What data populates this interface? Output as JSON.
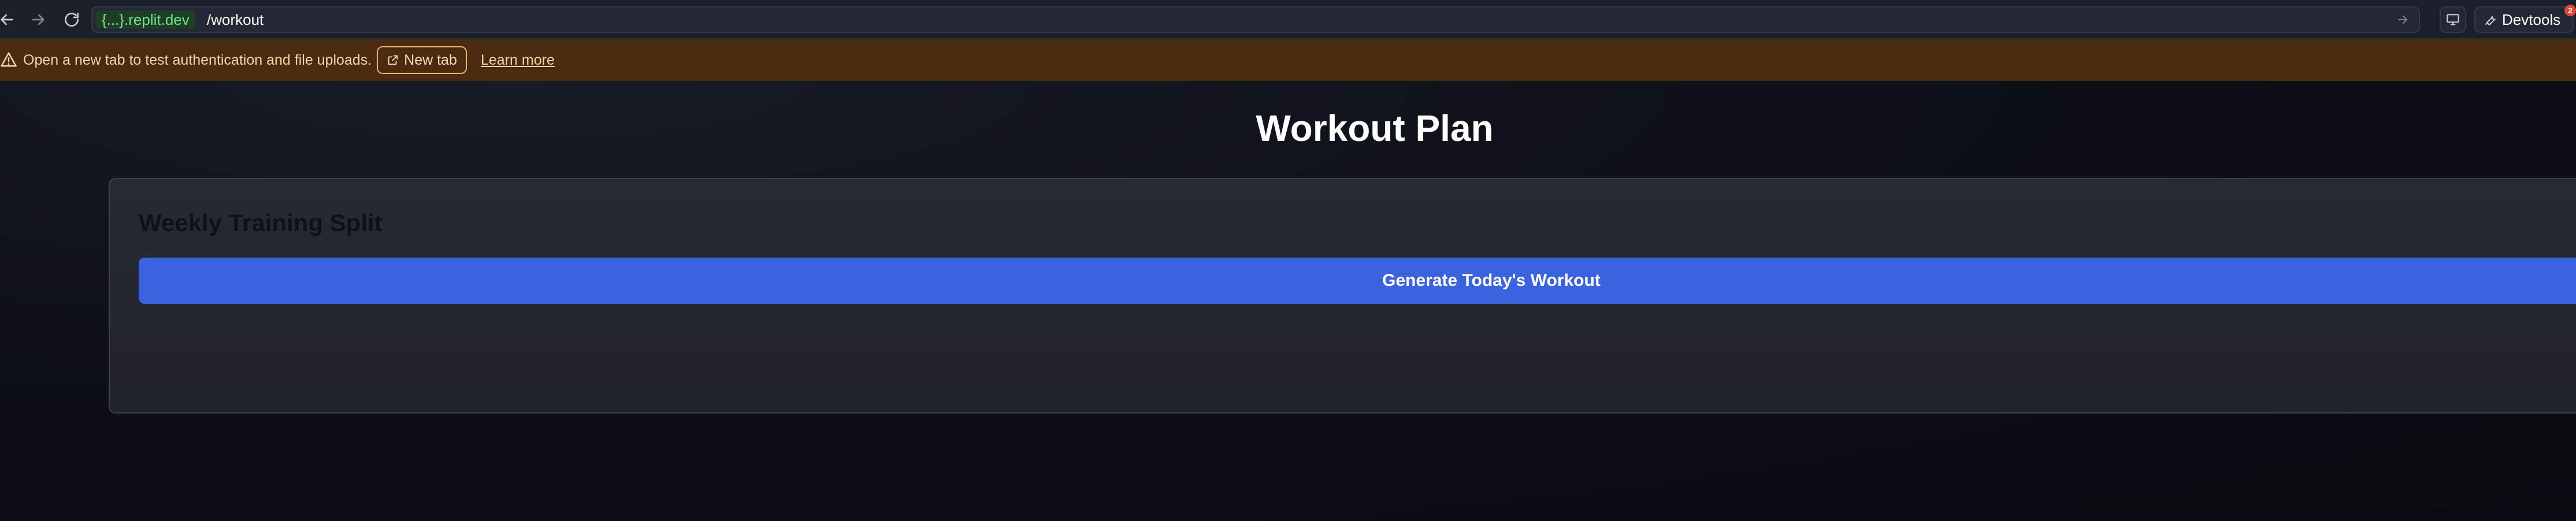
{
  "browser": {
    "url_domain": "{...}.replit.dev",
    "url_path": "/workout",
    "devtools_label": "Devtools",
    "devtools_badge": "2"
  },
  "banner": {
    "message": "Open a new tab to test authentication and file uploads.",
    "new_tab_label": "New tab",
    "learn_more_label": "Learn more"
  },
  "page": {
    "title": "Workout Plan",
    "card": {
      "title": "Weekly Training Split",
      "generate_button_label": "Generate Today's Workout"
    }
  },
  "colors": {
    "banner_bg": "#4a2b0e",
    "primary_button": "#3b63e0",
    "domain_chip_text": "#6fe085"
  },
  "icons": {
    "back": "arrow-left-icon",
    "forward": "arrow-right-icon",
    "reload": "reload-icon",
    "go": "arrow-right-small-icon",
    "screen": "monitor-icon",
    "devtools": "wrench-icon",
    "warning": "warning-triangle-icon",
    "external": "external-link-icon"
  }
}
